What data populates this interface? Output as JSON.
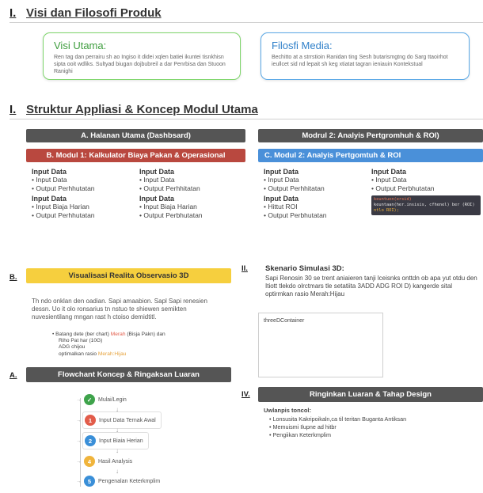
{
  "section1": {
    "num": "I.",
    "title": "Visi dan Filosofi Produk",
    "visi": {
      "title": "Visi Utama:",
      "text": "Ren tag dan perrairu sh ao Ingiso it didei xqlen batiei ikuntei tisnkhisn sipta ooit wdliks. Sultyad biugan dojbubreil a dar Penrbisa dan Stuoon Ranighi"
    },
    "filosofi": {
      "title": "Filosfi Media:",
      "text": "Bechitto at a strrstioin Ranidan ting Sesh butarismgtng do Sarg ttaoirhot ieullcet sid nd lepait sh keg xtiatat tagran ieniauin Kontekstual"
    }
  },
  "section2": {
    "num": "I.",
    "title": "Struktur Appliasi & Koncep Modul Utama",
    "bar_a": "A. Halanan Utama (Dashbsard)",
    "bar_b": "B. Modul 1: Kalkulator Biaya Pakan & Operasional",
    "bar_modul2": "Modrul 2: Analyis Pertgromhuh & ROI)",
    "bar_c": "C. Modul 2: Analyis Pertgomtuh & ROI",
    "b_col1": [
      {
        "title": "Input Data",
        "items": [
          "Input Data",
          "Output Perhhutatan"
        ]
      },
      {
        "title": "Input Data",
        "items": [
          "Input Biaja Harian",
          "Output Perhhutatan"
        ]
      }
    ],
    "b_col2": [
      {
        "title": "Input Data",
        "items": [
          "Input Data",
          "Output Perhhitatan"
        ]
      },
      {
        "title": "Input Data",
        "items": [
          "Input Biaja Harian",
          "Output Perbhutatan"
        ]
      }
    ],
    "c_col1": [
      {
        "title": "Input Data",
        "items": [
          "Input Data",
          "Output Perhhitatan"
        ]
      },
      {
        "title": "Input Data",
        "items": [
          "Hittut ROI",
          "Output Perbhutatan"
        ]
      }
    ],
    "c_col2": [
      {
        "title": "Input Data",
        "items": [
          "Input Data",
          "Output Perbhutatan"
        ]
      }
    ],
    "code": [
      "keuntuon(ersid)",
      "keuntaan(her.insisis, cfhenel) ber (ROI)",
      "ntlo ROI);"
    ]
  },
  "simulasi": {
    "num": "II.",
    "title": "Skenario Simulasi 3D:",
    "text": "Sapi Renosin 30 se trent aniaieren tanji lceisnks onttdn ob apa yut otdu den Itiott tlekdo olrctmars tle setatiita 3ADD ADG ROI D) kangerde sital optirmkan rasio Merah:Hijau",
    "container_label": "threeDContainer"
  },
  "visual": {
    "num": "B.",
    "title": "Visualisasi Realita Observasio 3D",
    "text": "Th ndo onklan den oadian. Sapi amaabion. Sapl Sapi renesien dessn. Uo it olo ronsarius tn nstuo te shiewen semikten nuvesientilang mngan rast h ctoiso demidtitl.",
    "note": {
      "line1_a": "Batang dete (ber chart)",
      "line1_red": "Merah",
      "line1_b": "(Bisja Pakn) dan",
      "line2": "Riho Pat har (10G)",
      "line3": "ADG chijou",
      "line4_a": "optimalkan rasio",
      "line4_red": "Merah:Hijau"
    },
    "colors": {
      "red": "#e25c4a",
      "orange": "#e6a23c"
    }
  },
  "flow": {
    "num": "A.",
    "title": "Flowchant Koncep & Ringaksan Luaran",
    "nodes": [
      {
        "n": "✓",
        "label": "Mulai/Legin",
        "color": "#3ea34b",
        "icon": "check-icon"
      },
      {
        "n": "1",
        "label": "Input Data Ternak Awal",
        "color": "#e25c4a",
        "icon": "step-1-icon"
      },
      {
        "n": "2",
        "label": "Input Biaia Herian",
        "color": "#3a8fd8",
        "icon": "step-2-icon"
      },
      {
        "n": "4",
        "label": "Hasil Analysis",
        "color": "#f0b43c",
        "icon": "step-4-icon"
      },
      {
        "n": "5",
        "label": "Pengenalan Keterkmplim",
        "color": "#3a8fd8",
        "icon": "step-5-icon"
      }
    ]
  },
  "ringkasan": {
    "num": "IV.",
    "title": "Ringinkan Luaran & Tahap Design",
    "subtitle": "Uwlanpis toncol:",
    "items": [
      "Lonsusita Kakripoikaln,ca til teritan Buganta Antiksan",
      "Memuismi Ilupne ad hitbr",
      "Pengiikan Keterkmplim"
    ]
  },
  "palette": {
    "green": "#7ed56b",
    "blue": "#5aa8e6",
    "dark": "#555555",
    "red": "#b9483f",
    "cblue": "#4a90d9",
    "yellow": "#f6cf3e"
  }
}
